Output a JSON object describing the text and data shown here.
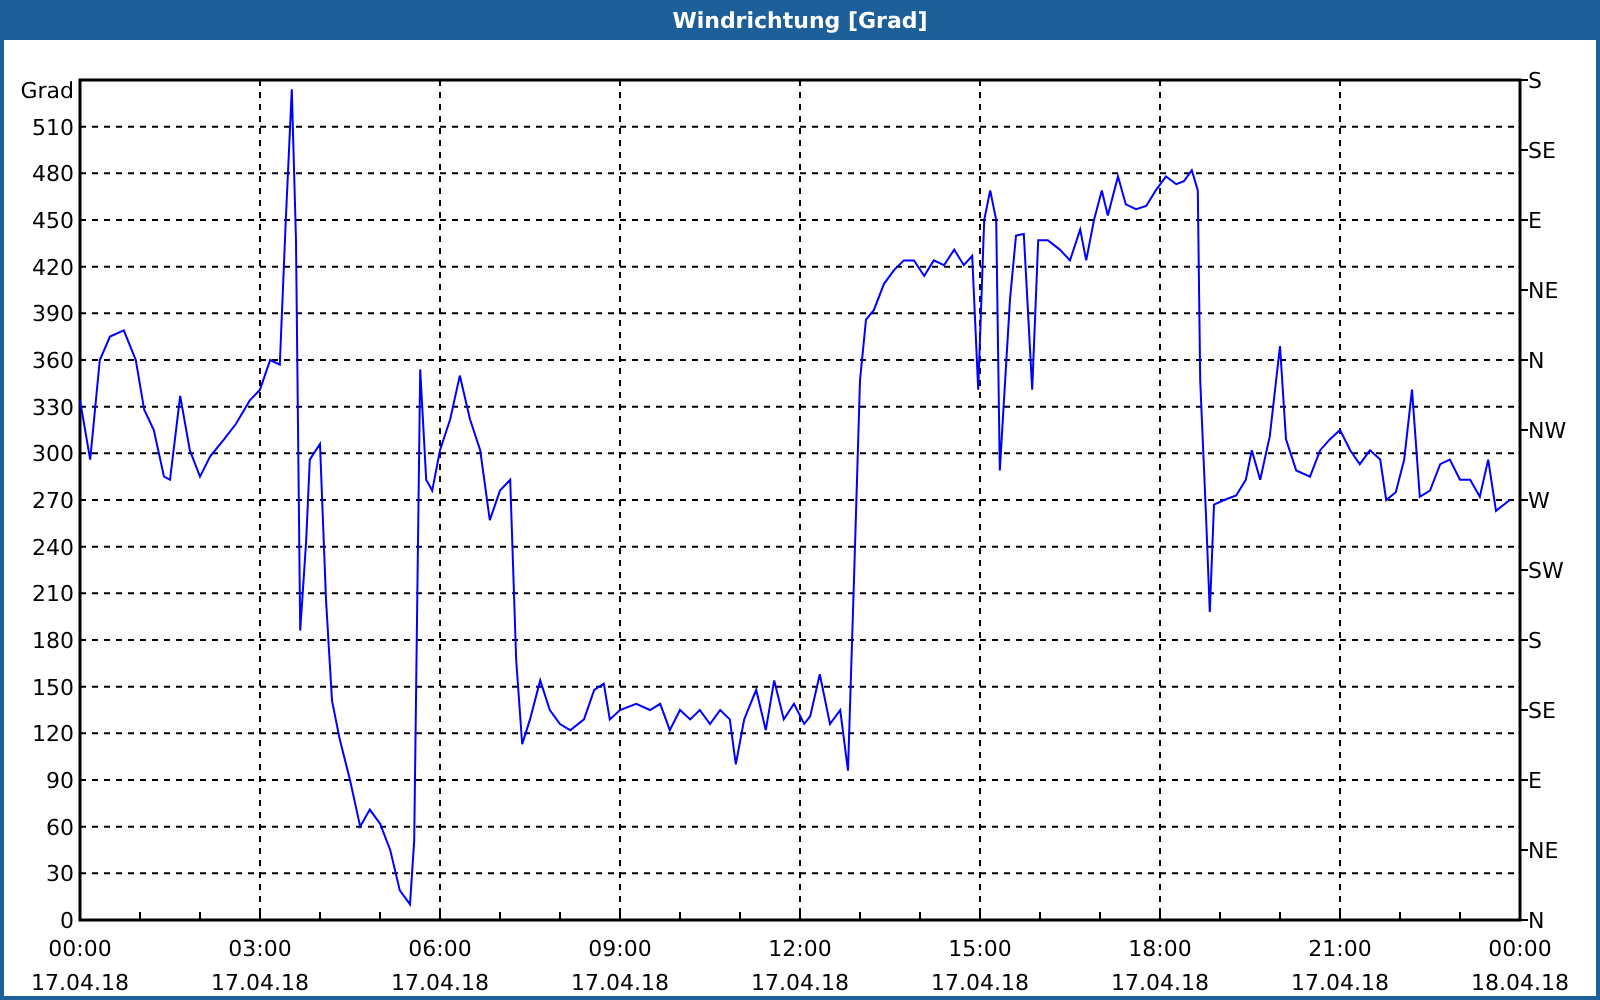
{
  "window": {
    "title": "Windrichtung [Grad]"
  },
  "chart": {
    "x_axis_dates": [
      "17.04.18",
      "17.04.18",
      "17.04.18",
      "17.04.18",
      "17.04.18",
      "17.04.18",
      "17.04.18",
      "17.04.18",
      "18.04.18"
    ],
    "chart_data": {
      "type": "line",
      "grid": true,
      "ylabel": "Grad",
      "xlim": [
        0,
        24
      ],
      "ylim": [
        0,
        540
      ],
      "yticks": [
        0,
        30,
        60,
        90,
        120,
        150,
        180,
        210,
        240,
        270,
        300,
        330,
        360,
        390,
        420,
        450,
        480,
        510
      ],
      "xticks": [
        {
          "value": 0,
          "label": "00:00"
        },
        {
          "value": 3,
          "label": "03:00"
        },
        {
          "value": 6,
          "label": "06:00"
        },
        {
          "value": 9,
          "label": "09:00"
        },
        {
          "value": 12,
          "label": "12:00"
        },
        {
          "value": 15,
          "label": "15:00"
        },
        {
          "value": 18,
          "label": "18:00"
        },
        {
          "value": 21,
          "label": "21:00"
        },
        {
          "value": 24,
          "label": "00:00"
        }
      ],
      "x": [
        0,
        0.17,
        0.33,
        0.5,
        0.73,
        0.93,
        1.07,
        1.23,
        1.4,
        1.5,
        1.67,
        1.83,
        2,
        2.17,
        2.4,
        2.6,
        2.83,
        3,
        3.17,
        3.33,
        3.43,
        3.53,
        3.6,
        3.67,
        3.77,
        3.83,
        4,
        4.1,
        4.2,
        4.33,
        4.5,
        4.67,
        4.83,
        5,
        5.17,
        5.33,
        5.5,
        5.57,
        5.67,
        5.77,
        5.87,
        6,
        6.17,
        6.33,
        6.5,
        6.67,
        6.83,
        7,
        7.17,
        7.27,
        7.37,
        7.5,
        7.67,
        7.83,
        8,
        8.17,
        8.4,
        8.57,
        8.73,
        8.83,
        9,
        9.27,
        9.5,
        9.67,
        9.83,
        10,
        10.17,
        10.33,
        10.5,
        10.67,
        10.83,
        10.93,
        11.07,
        11.27,
        11.43,
        11.57,
        11.73,
        11.9,
        12.07,
        12.17,
        12.33,
        12.5,
        12.67,
        12.8,
        12.9,
        13,
        13.1,
        13.23,
        13.4,
        13.57,
        13.73,
        13.9,
        14.07,
        14.23,
        14.4,
        14.57,
        14.73,
        14.87,
        14.97,
        15.07,
        15.17,
        15.27,
        15.33,
        15.5,
        15.6,
        15.73,
        15.87,
        15.97,
        16.13,
        16.33,
        16.5,
        16.67,
        16.77,
        16.9,
        17.03,
        17.13,
        17.3,
        17.43,
        17.6,
        17.77,
        17.93,
        18.1,
        18.27,
        18.4,
        18.53,
        18.63,
        18.67,
        18.77,
        18.83,
        18.9,
        19.07,
        19.27,
        19.43,
        19.53,
        19.67,
        19.83,
        20,
        20.1,
        20.27,
        20.5,
        20.67,
        20.83,
        21,
        21.17,
        21.33,
        21.5,
        21.67,
        21.77,
        21.93,
        22.07,
        22.2,
        22.33,
        22.5,
        22.67,
        22.83,
        23,
        23.17,
        23.33,
        23.47,
        23.6,
        23.83
      ],
      "series": [
        {
          "color": "#0000ff",
          "values": [
            334,
            296,
            360,
            375,
            379,
            360,
            328,
            315,
            285,
            283,
            337,
            302,
            285,
            298,
            309,
            319,
            334,
            341,
            360,
            357,
            450,
            534,
            437,
            186,
            244,
            296,
            306,
            206,
            141,
            116,
            90,
            60,
            71,
            62,
            45,
            19,
            10,
            51,
            354,
            283,
            276,
            302,
            322,
            350,
            322,
            302,
            257,
            276,
            283,
            167,
            113,
            129,
            154,
            135,
            126,
            122,
            129,
            148,
            152,
            129,
            135,
            139,
            135,
            139,
            122,
            135,
            129,
            135,
            126,
            135,
            129,
            100,
            129,
            148,
            122,
            154,
            129,
            139,
            126,
            131,
            158,
            126,
            135,
            96,
            219,
            347,
            386,
            392,
            409,
            418,
            424,
            424,
            414,
            424,
            421,
            431,
            421,
            427,
            341,
            450,
            469,
            450,
            289,
            399,
            440,
            441,
            341,
            437,
            437,
            431,
            424,
            444,
            424,
            450,
            469,
            453,
            478,
            460,
            457,
            459,
            469,
            478,
            473,
            475,
            482,
            469,
            347,
            257,
            198,
            267,
            270,
            273,
            283,
            302,
            283,
            311,
            369,
            309,
            289,
            285,
            302,
            309,
            315,
            302,
            293,
            302,
            296,
            270,
            275,
            296,
            341,
            272,
            276,
            293,
            296,
            283,
            283,
            272,
            296,
            263,
            270
          ]
        }
      ]
    },
    "right_axis": {
      "labels": [
        "S",
        "SE",
        "E",
        "NE",
        "N",
        "NW",
        "W",
        "SW",
        "S",
        "SE",
        "E",
        "NE",
        "N"
      ]
    }
  }
}
